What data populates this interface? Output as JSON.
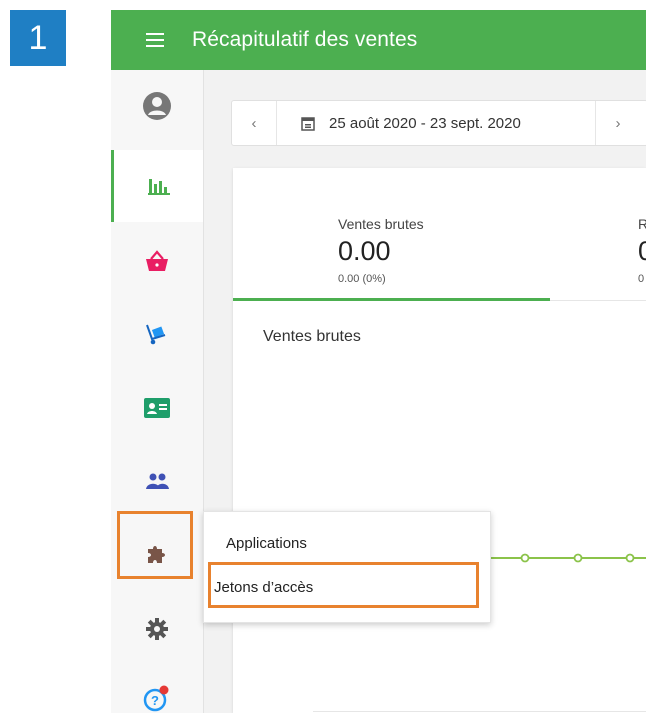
{
  "step_number": "1",
  "header": {
    "title": "Récapitulatif des ventes",
    "menu_icon": "hamburger-menu-icon"
  },
  "sidebar": {
    "items": [
      {
        "name": "account",
        "icon": "user-circle-icon",
        "color": "#777777"
      },
      {
        "name": "reports",
        "icon": "bar-chart-icon",
        "color": "#4caf50",
        "active": true
      },
      {
        "name": "sales",
        "icon": "shopping-basket-icon",
        "color": "#e91e63"
      },
      {
        "name": "items",
        "icon": "hand-truck-icon",
        "color": "#2196f3"
      },
      {
        "name": "employees",
        "icon": "id-card-icon",
        "color": "#1e9e6a"
      },
      {
        "name": "customers",
        "icon": "people-icon",
        "color": "#3f51b5"
      },
      {
        "name": "integrations",
        "icon": "puzzle-icon",
        "color": "#795548"
      },
      {
        "name": "settings",
        "icon": "gear-icon",
        "color": "#555555"
      },
      {
        "name": "help",
        "icon": "help-icon",
        "color": "#2196f3"
      }
    ]
  },
  "date_filter": {
    "range": "25 août 2020 - 23 sept. 2020",
    "prev": "‹",
    "next": "›"
  },
  "summary": {
    "kpi_label": "Ventes brutes",
    "kpi_value": "0.00",
    "kpi_change": "0.00 (0%)",
    "kpi2_label_partial": "R",
    "kpi2_value_partial": "0",
    "kpi2_sub_partial": "0"
  },
  "chart": {
    "title": "Ventes brutes",
    "line_color": "#8bc34a"
  },
  "popup_menu": {
    "items": [
      "Applications",
      "Jetons d’accès"
    ]
  },
  "highlight_color": "#e8822e",
  "accent_color": "#4caf50"
}
